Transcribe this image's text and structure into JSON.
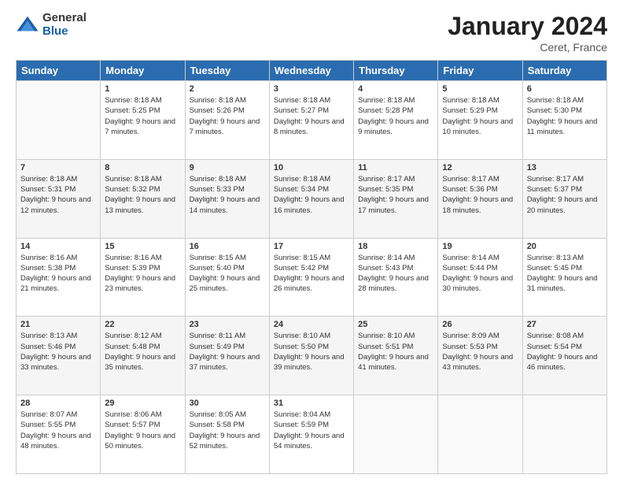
{
  "header": {
    "logo_general": "General",
    "logo_blue": "Blue",
    "main_title": "January 2024",
    "subtitle": "Ceret, France"
  },
  "weekdays": [
    "Sunday",
    "Monday",
    "Tuesday",
    "Wednesday",
    "Thursday",
    "Friday",
    "Saturday"
  ],
  "weeks": [
    [
      {
        "day": "",
        "sunrise": "",
        "sunset": "",
        "daylight": ""
      },
      {
        "day": "1",
        "sunrise": "Sunrise: 8:18 AM",
        "sunset": "Sunset: 5:25 PM",
        "daylight": "Daylight: 9 hours and 7 minutes."
      },
      {
        "day": "2",
        "sunrise": "Sunrise: 8:18 AM",
        "sunset": "Sunset: 5:26 PM",
        "daylight": "Daylight: 9 hours and 7 minutes."
      },
      {
        "day": "3",
        "sunrise": "Sunrise: 8:18 AM",
        "sunset": "Sunset: 5:27 PM",
        "daylight": "Daylight: 9 hours and 8 minutes."
      },
      {
        "day": "4",
        "sunrise": "Sunrise: 8:18 AM",
        "sunset": "Sunset: 5:28 PM",
        "daylight": "Daylight: 9 hours and 9 minutes."
      },
      {
        "day": "5",
        "sunrise": "Sunrise: 8:18 AM",
        "sunset": "Sunset: 5:29 PM",
        "daylight": "Daylight: 9 hours and 10 minutes."
      },
      {
        "day": "6",
        "sunrise": "Sunrise: 8:18 AM",
        "sunset": "Sunset: 5:30 PM",
        "daylight": "Daylight: 9 hours and 11 minutes."
      }
    ],
    [
      {
        "day": "7",
        "sunrise": "Sunrise: 8:18 AM",
        "sunset": "Sunset: 5:31 PM",
        "daylight": "Daylight: 9 hours and 12 minutes."
      },
      {
        "day": "8",
        "sunrise": "Sunrise: 8:18 AM",
        "sunset": "Sunset: 5:32 PM",
        "daylight": "Daylight: 9 hours and 13 minutes."
      },
      {
        "day": "9",
        "sunrise": "Sunrise: 8:18 AM",
        "sunset": "Sunset: 5:33 PM",
        "daylight": "Daylight: 9 hours and 14 minutes."
      },
      {
        "day": "10",
        "sunrise": "Sunrise: 8:18 AM",
        "sunset": "Sunset: 5:34 PM",
        "daylight": "Daylight: 9 hours and 16 minutes."
      },
      {
        "day": "11",
        "sunrise": "Sunrise: 8:17 AM",
        "sunset": "Sunset: 5:35 PM",
        "daylight": "Daylight: 9 hours and 17 minutes."
      },
      {
        "day": "12",
        "sunrise": "Sunrise: 8:17 AM",
        "sunset": "Sunset: 5:36 PM",
        "daylight": "Daylight: 9 hours and 18 minutes."
      },
      {
        "day": "13",
        "sunrise": "Sunrise: 8:17 AM",
        "sunset": "Sunset: 5:37 PM",
        "daylight": "Daylight: 9 hours and 20 minutes."
      }
    ],
    [
      {
        "day": "14",
        "sunrise": "Sunrise: 8:16 AM",
        "sunset": "Sunset: 5:38 PM",
        "daylight": "Daylight: 9 hours and 21 minutes."
      },
      {
        "day": "15",
        "sunrise": "Sunrise: 8:16 AM",
        "sunset": "Sunset: 5:39 PM",
        "daylight": "Daylight: 9 hours and 23 minutes."
      },
      {
        "day": "16",
        "sunrise": "Sunrise: 8:15 AM",
        "sunset": "Sunset: 5:40 PM",
        "daylight": "Daylight: 9 hours and 25 minutes."
      },
      {
        "day": "17",
        "sunrise": "Sunrise: 8:15 AM",
        "sunset": "Sunset: 5:42 PM",
        "daylight": "Daylight: 9 hours and 26 minutes."
      },
      {
        "day": "18",
        "sunrise": "Sunrise: 8:14 AM",
        "sunset": "Sunset: 5:43 PM",
        "daylight": "Daylight: 9 hours and 28 minutes."
      },
      {
        "day": "19",
        "sunrise": "Sunrise: 8:14 AM",
        "sunset": "Sunset: 5:44 PM",
        "daylight": "Daylight: 9 hours and 30 minutes."
      },
      {
        "day": "20",
        "sunrise": "Sunrise: 8:13 AM",
        "sunset": "Sunset: 5:45 PM",
        "daylight": "Daylight: 9 hours and 31 minutes."
      }
    ],
    [
      {
        "day": "21",
        "sunrise": "Sunrise: 8:13 AM",
        "sunset": "Sunset: 5:46 PM",
        "daylight": "Daylight: 9 hours and 33 minutes."
      },
      {
        "day": "22",
        "sunrise": "Sunrise: 8:12 AM",
        "sunset": "Sunset: 5:48 PM",
        "daylight": "Daylight: 9 hours and 35 minutes."
      },
      {
        "day": "23",
        "sunrise": "Sunrise: 8:11 AM",
        "sunset": "Sunset: 5:49 PM",
        "daylight": "Daylight: 9 hours and 37 minutes."
      },
      {
        "day": "24",
        "sunrise": "Sunrise: 8:10 AM",
        "sunset": "Sunset: 5:50 PM",
        "daylight": "Daylight: 9 hours and 39 minutes."
      },
      {
        "day": "25",
        "sunrise": "Sunrise: 8:10 AM",
        "sunset": "Sunset: 5:51 PM",
        "daylight": "Daylight: 9 hours and 41 minutes."
      },
      {
        "day": "26",
        "sunrise": "Sunrise: 8:09 AM",
        "sunset": "Sunset: 5:53 PM",
        "daylight": "Daylight: 9 hours and 43 minutes."
      },
      {
        "day": "27",
        "sunrise": "Sunrise: 8:08 AM",
        "sunset": "Sunset: 5:54 PM",
        "daylight": "Daylight: 9 hours and 46 minutes."
      }
    ],
    [
      {
        "day": "28",
        "sunrise": "Sunrise: 8:07 AM",
        "sunset": "Sunset: 5:55 PM",
        "daylight": "Daylight: 9 hours and 48 minutes."
      },
      {
        "day": "29",
        "sunrise": "Sunrise: 8:06 AM",
        "sunset": "Sunset: 5:57 PM",
        "daylight": "Daylight: 9 hours and 50 minutes."
      },
      {
        "day": "30",
        "sunrise": "Sunrise: 8:05 AM",
        "sunset": "Sunset: 5:58 PM",
        "daylight": "Daylight: 9 hours and 52 minutes."
      },
      {
        "day": "31",
        "sunrise": "Sunrise: 8:04 AM",
        "sunset": "Sunset: 5:59 PM",
        "daylight": "Daylight: 9 hours and 54 minutes."
      },
      {
        "day": "",
        "sunrise": "",
        "sunset": "",
        "daylight": ""
      },
      {
        "day": "",
        "sunrise": "",
        "sunset": "",
        "daylight": ""
      },
      {
        "day": "",
        "sunrise": "",
        "sunset": "",
        "daylight": ""
      }
    ]
  ]
}
